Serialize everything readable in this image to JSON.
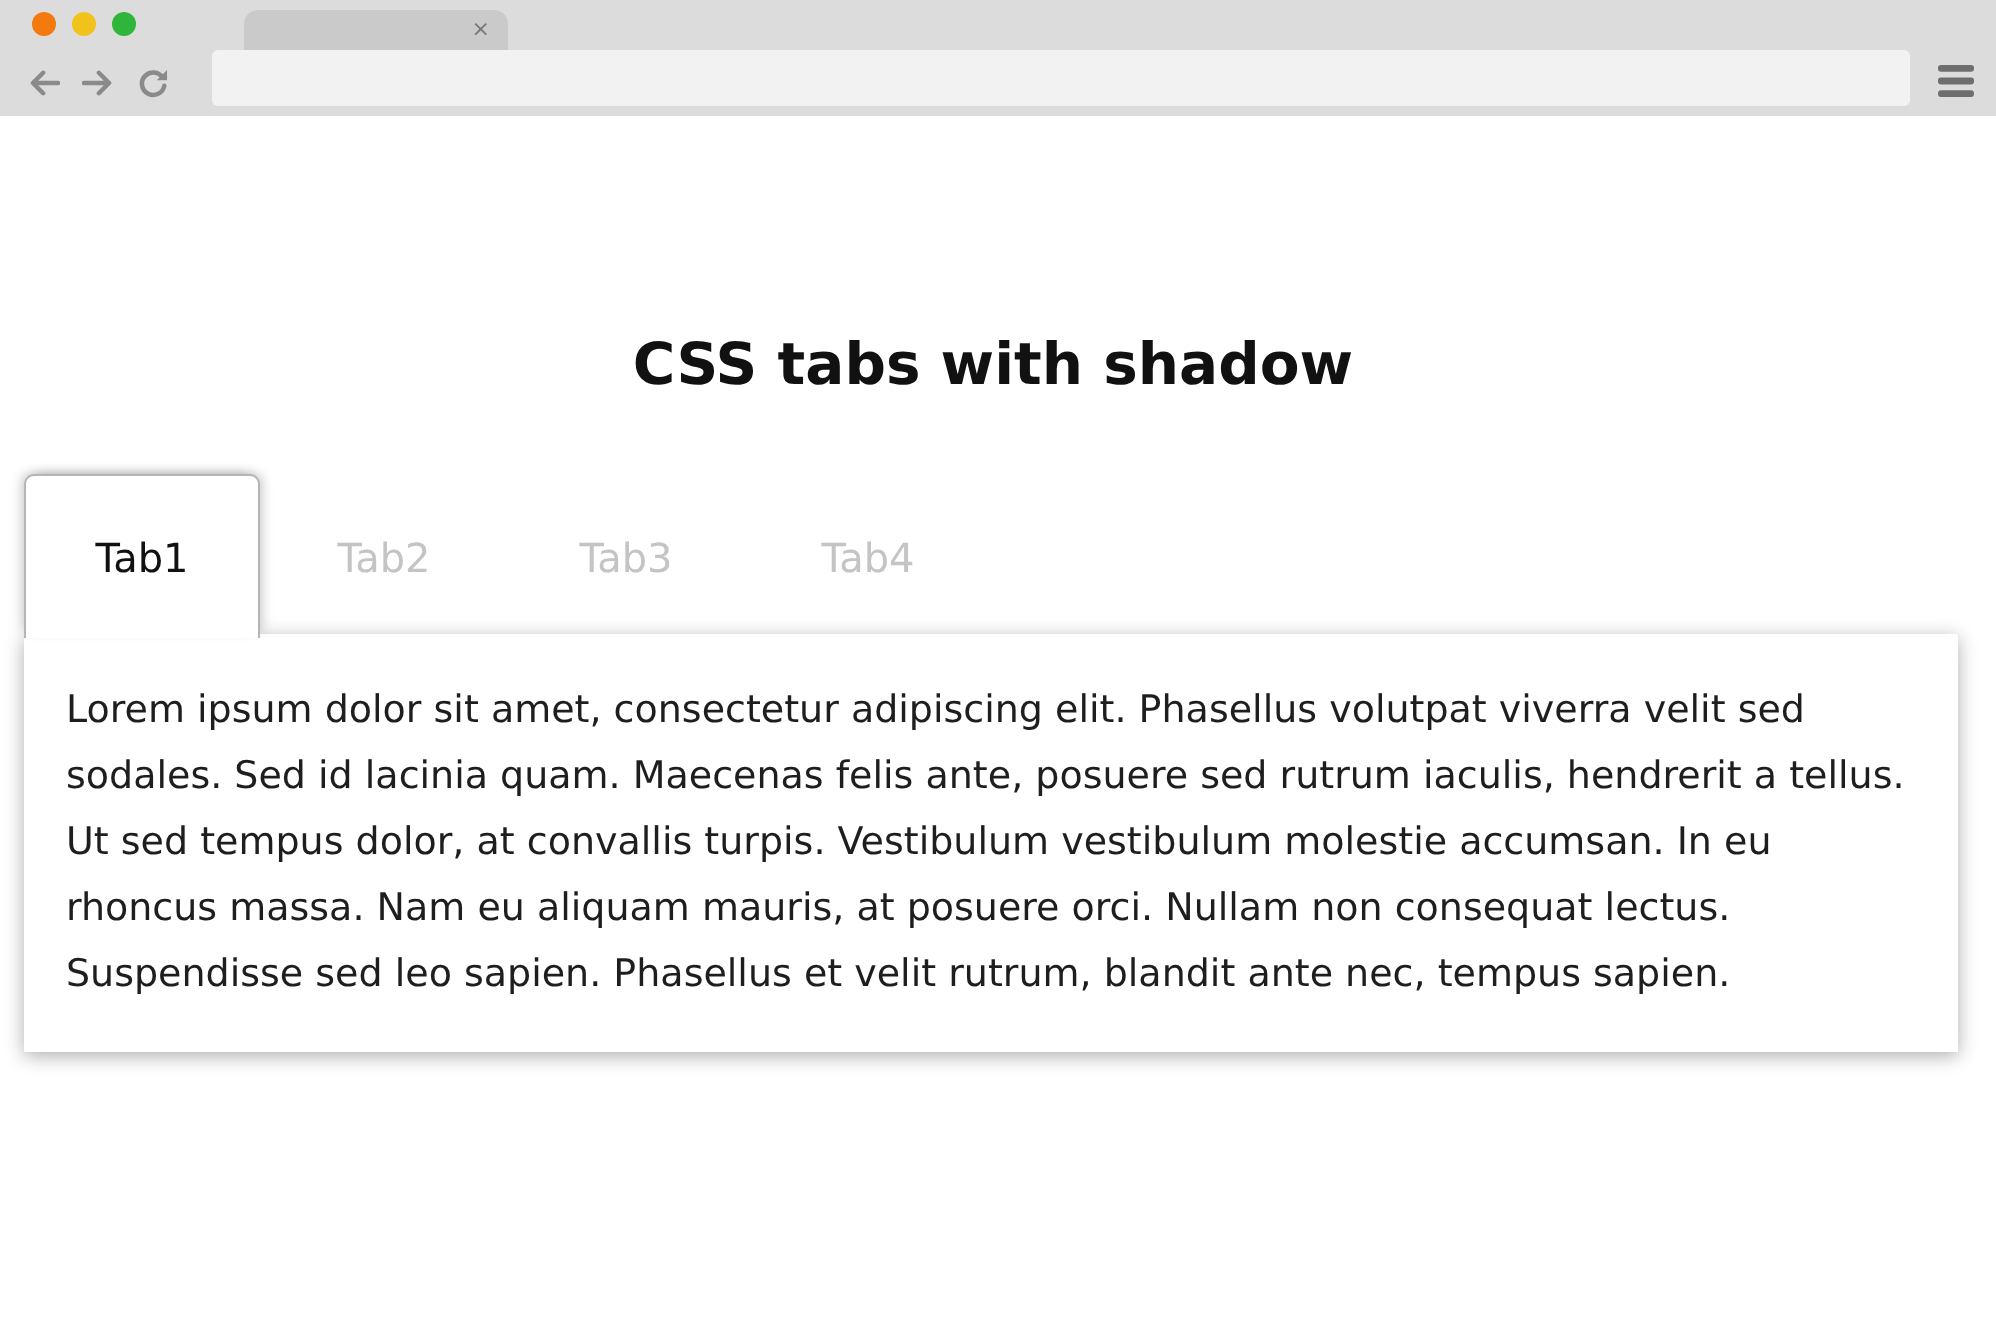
{
  "browser": {
    "tab_close": "×"
  },
  "page": {
    "title": "CSS tabs with shadow"
  },
  "tabs": [
    {
      "label": "Tab1",
      "selected": true
    },
    {
      "label": "Tab2",
      "selected": false
    },
    {
      "label": "Tab3",
      "selected": false
    },
    {
      "label": "Tab4",
      "selected": false
    }
  ],
  "panel": {
    "text": "Lorem ipsum dolor sit amet, consectetur adipiscing elit. Phasellus volutpat viverra velit sed sodales. Sed id lacinia quam. Maecenas felis ante, posuere sed rutrum iaculis, hendrerit a tellus. Ut sed tempus dolor, at convallis turpis. Vestibulum vestibulum molestie accumsan. In eu rhoncus massa. Nam eu aliquam mauris, at posuere orci. Nullam non consequat lectus. Suspendisse sed leo sapien. Phasellus et velit rutrum, blandit ante nec, tempus sapien."
  }
}
